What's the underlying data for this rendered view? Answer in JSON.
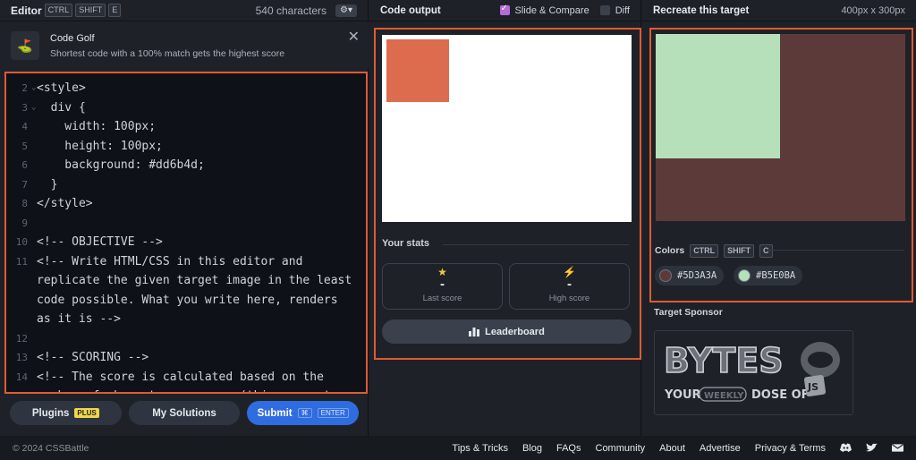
{
  "editor": {
    "title": "Editor",
    "kbd": [
      "CTRL",
      "SHIFT",
      "E"
    ],
    "characters": "540 characters",
    "golf_title": "Code Golf",
    "golf_subtitle": "Shortest code with a 100% match gets the highest score",
    "lines": [
      {
        "n": "2",
        "fold": "⌄",
        "text": "<style>"
      },
      {
        "n": "3",
        "fold": "⌄",
        "text": "  div {"
      },
      {
        "n": "4",
        "fold": "",
        "text": "    width: 100px;"
      },
      {
        "n": "5",
        "fold": "",
        "text": "    height: 100px;"
      },
      {
        "n": "6",
        "fold": "",
        "text": "    background: #dd6b4d;"
      },
      {
        "n": "7",
        "fold": "",
        "text": "  }"
      },
      {
        "n": "8",
        "fold": "",
        "text": "</style>"
      },
      {
        "n": "9",
        "fold": "",
        "text": ""
      },
      {
        "n": "10",
        "fold": "",
        "text": "<!-- OBJECTIVE -->"
      },
      {
        "n": "11",
        "fold": "",
        "text": "<!-- Write HTML/CSS in this editor and"
      },
      {
        "n": "",
        "fold": "",
        "text": "replicate the given target image in the least"
      },
      {
        "n": "",
        "fold": "",
        "text": "code possible. What you write here, renders"
      },
      {
        "n": "",
        "fold": "",
        "text": "as it is -->"
      },
      {
        "n": "12",
        "fold": "",
        "text": ""
      },
      {
        "n": "13",
        "fold": "",
        "text": "<!-- SCORING -->"
      },
      {
        "n": "14",
        "fold": "",
        "text": "<!-- The score is calculated based on the"
      },
      {
        "n": "",
        "fold": "",
        "text": "number of characters you use (this comment"
      }
    ],
    "buttons": {
      "plugins": "Plugins",
      "plugins_badge": "PLUS",
      "solutions": "My Solutions",
      "submit": "Submit",
      "submit_kbd1": "⌘",
      "submit_kbd2": "ENTER"
    }
  },
  "output": {
    "title": "Code output",
    "slide_compare": "Slide & Compare",
    "diff": "Diff",
    "shape_color": "#dd6b4d",
    "stats_title": "Your stats",
    "last_score_value": "-",
    "last_score_label": "Last score",
    "high_score_value": "-",
    "high_score_label": "High score",
    "leaderboard": "Leaderboard"
  },
  "target": {
    "title": "Recreate this target",
    "dims": "400px x 300px",
    "colors_title": "Colors",
    "kbd": [
      "CTRL",
      "SHIFT",
      "C"
    ],
    "colors": [
      {
        "hex": "#5D3A3A",
        "value": "#5d3a3a"
      },
      {
        "hex": "#B5E0BA",
        "value": "#b5e0ba"
      }
    ],
    "sponsor_title": "Target Sponsor",
    "sponsor_word": "BYTES",
    "sponsor_your": "YOUR",
    "sponsor_weekly": "WEEKLY",
    "sponsor_dose": "DOSE OF",
    "sponsor_js": "JS"
  },
  "footer": {
    "copyright": "© 2024 CSSBattle",
    "links": [
      "Tips & Tricks",
      "Blog",
      "FAQs",
      "Community",
      "About",
      "Advertise",
      "Privacy & Terms"
    ]
  }
}
